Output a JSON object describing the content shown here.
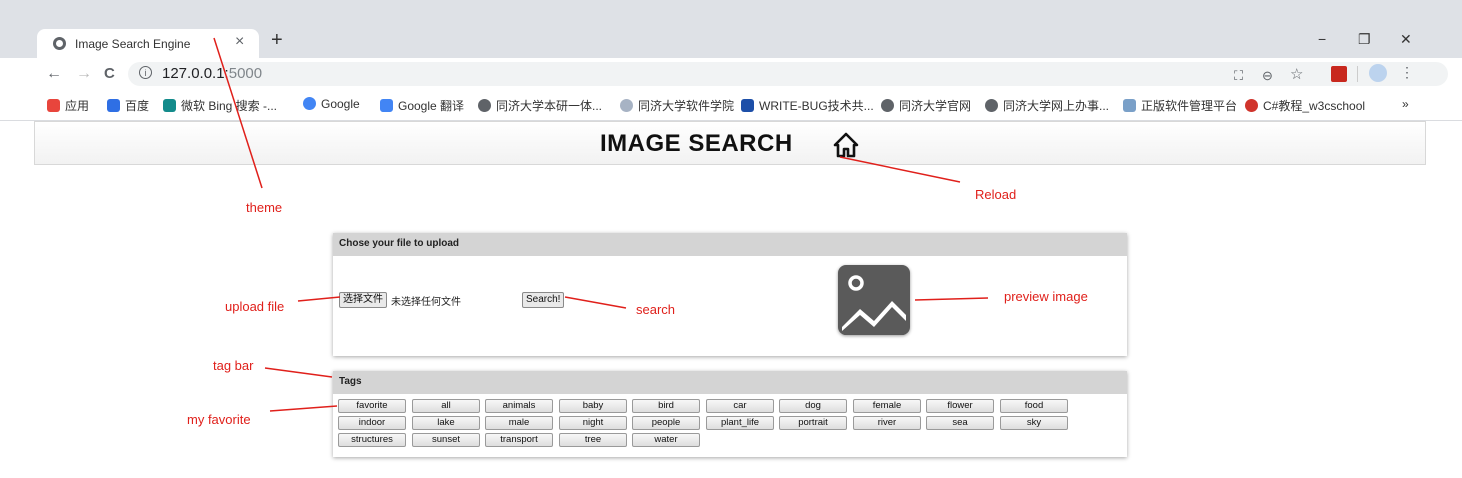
{
  "browser": {
    "tab_title": "Image Search Engine",
    "tab_close": "×",
    "new_tab": "+",
    "window_controls": [
      "−",
      "❐",
      "✕"
    ],
    "nav": {
      "back": "←",
      "forward": "→",
      "reload": "C"
    },
    "url_host": "127.0.0.1:",
    "url_port": "5000",
    "bookmarks": [
      {
        "label": "应用",
        "color": "#e8453c"
      },
      {
        "label": "百度",
        "color": "#2f6fe4"
      },
      {
        "label": "微软 Bing 搜索 -...",
        "color": "#138b8b"
      },
      {
        "label": "Google",
        "color": "#4285f4"
      },
      {
        "label": "Google 翻译",
        "color": "#4285f4"
      },
      {
        "label": "同济大学本研一体...",
        "color": "#5f6368"
      },
      {
        "label": "同济大学软件学院",
        "color": "#a7b3c4"
      },
      {
        "label": "WRITE-BUG技术共...",
        "color": "#1d4fa8"
      },
      {
        "label": "同济大学官网",
        "color": "#5f6368"
      },
      {
        "label": "同济大学网上办事...",
        "color": "#5f6368"
      },
      {
        "label": "正版软件管理平台",
        "color": "#7aa0c8"
      },
      {
        "label": "C#教程_w3cschool",
        "color": "#d0342c"
      }
    ],
    "bookmarks_more": "»"
  },
  "header": {
    "title": "IMAGE SEARCH",
    "home_icon": "home-icon"
  },
  "upload_panel": {
    "title": "Chose your file to upload",
    "choose_file_label": "选择文件",
    "file_status": "未选择任何文件",
    "search_label": "Search!",
    "preview_icon": "image-placeholder-icon"
  },
  "tags_panel": {
    "title": "Tags",
    "tags": [
      "favorite",
      "all",
      "animals",
      "baby",
      "bird",
      "car",
      "dog",
      "female",
      "flower",
      "food",
      "indoor",
      "lake",
      "male",
      "night",
      "people",
      "plant_life",
      "portrait",
      "river",
      "sea",
      "sky",
      "structures",
      "sunset",
      "transport",
      "tree",
      "water"
    ]
  },
  "annotations": {
    "theme": "theme",
    "reload": "Reload",
    "upload_file": "upload file",
    "search": "search",
    "preview_image": "preview image",
    "tag_bar": "tag bar",
    "my_favorite": "my favorite",
    "color": "#e0201b"
  }
}
